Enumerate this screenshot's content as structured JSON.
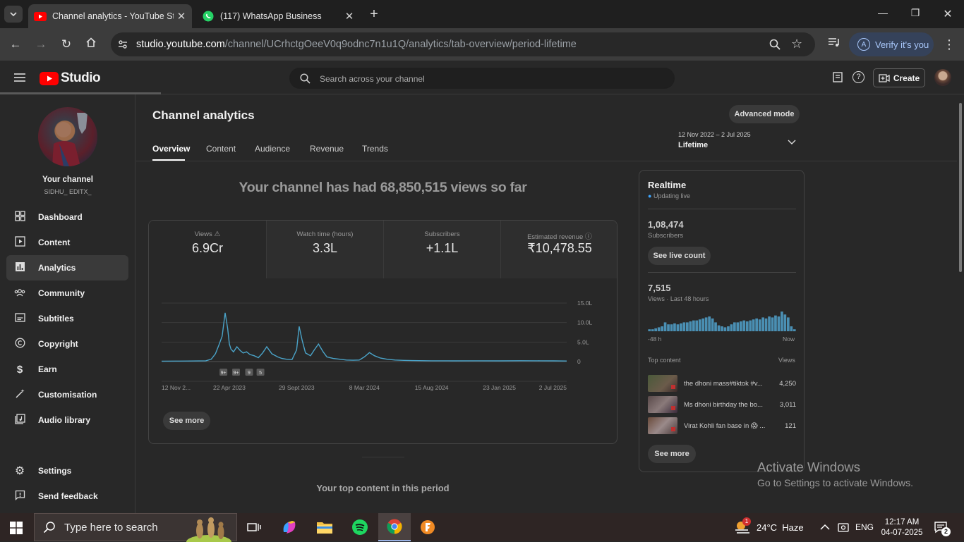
{
  "browser": {
    "tabs": [
      {
        "title": "Channel analytics - YouTube Studio",
        "active": true
      },
      {
        "title": "(117) WhatsApp Business",
        "active": false
      }
    ],
    "url_host": "studio.youtube.com",
    "url_path": "/channel/UCrhctgOeeV0q9odnc7n1u1Q/analytics/tab-overview/period-lifetime",
    "verify_label": "Verify it's you",
    "verify_initial": "A"
  },
  "studio": {
    "logo_text": "Studio",
    "search_placeholder": "Search across your channel",
    "create_label": "Create"
  },
  "sidebar": {
    "channel_label": "Your channel",
    "channel_name": "SIDHU_ EDITX_",
    "items": [
      {
        "label": "Dashboard",
        "icon": "dashboard-icon"
      },
      {
        "label": "Content",
        "icon": "content-icon"
      },
      {
        "label": "Analytics",
        "icon": "analytics-icon",
        "selected": true
      },
      {
        "label": "Community",
        "icon": "community-icon"
      },
      {
        "label": "Subtitles",
        "icon": "subtitles-icon"
      },
      {
        "label": "Copyright",
        "icon": "copyright-icon"
      },
      {
        "label": "Earn",
        "icon": "earn-icon"
      },
      {
        "label": "Customisation",
        "icon": "customisation-icon"
      },
      {
        "label": "Audio library",
        "icon": "audio-library-icon"
      }
    ],
    "bottom_items": [
      {
        "label": "Settings",
        "icon": "gear-icon"
      },
      {
        "label": "Send feedback",
        "icon": "feedback-icon"
      }
    ]
  },
  "analytics": {
    "page_title": "Channel analytics",
    "advanced_mode_label": "Advanced mode",
    "tabs": [
      "Overview",
      "Content",
      "Audience",
      "Revenue",
      "Trends"
    ],
    "period_range": "12 Nov 2022 – 2 Jul 2025",
    "period_label": "Lifetime",
    "headline": "Your channel has had 68,850,515 views so far",
    "metrics": [
      {
        "label": "Views",
        "value": "6.9Cr"
      },
      {
        "label": "Watch time (hours)",
        "value": "3.3L"
      },
      {
        "label": "Subscribers",
        "value": "+1.1L"
      },
      {
        "label": "Estimated revenue",
        "value": "₹10,478.55"
      }
    ],
    "see_more_label": "See more",
    "top_content_heading": "Your top content in this period"
  },
  "chart_data": {
    "type": "line",
    "x_ticks": [
      "12 Nov 2...",
      "22 Apr 2023",
      "29 Sept 2023",
      "8 Mar 2024",
      "15 Aug 2024",
      "23 Jan 2025",
      "2 Jul 2025"
    ],
    "y_ticks": [
      "15.0L",
      "10.0L",
      "5.0L",
      "0"
    ],
    "ylim": [
      0,
      1500000
    ],
    "grid": true,
    "series": [
      {
        "x": [
          "2022-11-12",
          "2022-12-15",
          "2023-01-20",
          "2023-02-25",
          "2023-03-10",
          "2023-03-20",
          "2023-03-28",
          "2023-04-05",
          "2023-04-12",
          "2023-04-18",
          "2023-04-22",
          "2023-04-26",
          "2023-05-02",
          "2023-05-10",
          "2023-05-18",
          "2023-05-25",
          "2023-06-02",
          "2023-06-10",
          "2023-06-20",
          "2023-06-30",
          "2023-07-10",
          "2023-07-20",
          "2023-08-01",
          "2023-08-15",
          "2023-08-25",
          "2023-09-05",
          "2023-09-18",
          "2023-09-29",
          "2023-10-05",
          "2023-10-12",
          "2023-10-20",
          "2023-11-01",
          "2023-11-10",
          "2023-11-20",
          "2023-12-01",
          "2023-12-10",
          "2023-12-25",
          "2024-01-10",
          "2024-01-25",
          "2024-02-10",
          "2024-02-25",
          "2024-03-08",
          "2024-03-20",
          "2024-04-01",
          "2024-04-15",
          "2024-05-01",
          "2024-05-20",
          "2024-06-10",
          "2024-07-01",
          "2024-08-15",
          "2024-10-01",
          "2024-12-01",
          "2025-01-23",
          "2025-03-15",
          "2025-05-01",
          "2025-06-01",
          "2025-07-02"
        ],
        "values": [
          10000,
          12000,
          15000,
          20000,
          60000,
          200000,
          420000,
          650000,
          1250000,
          850000,
          450000,
          320000,
          250000,
          380000,
          280000,
          220000,
          250000,
          180000,
          150000,
          100000,
          220000,
          380000,
          200000,
          120000,
          80000,
          60000,
          50000,
          300000,
          900000,
          550000,
          220000,
          150000,
          300000,
          450000,
          250000,
          120000,
          80000,
          60000,
          40000,
          35000,
          40000,
          120000,
          230000,
          150000,
          90000,
          60000,
          40000,
          30000,
          25000,
          20000,
          18000,
          20000,
          18000,
          22000,
          20000,
          18000,
          15000
        ]
      }
    ]
  },
  "realtime": {
    "title": "Realtime",
    "status": "Updating live",
    "subscribers_value": "1,08,474",
    "subscribers_label": "Subscribers",
    "see_live_count_label": "See live count",
    "views_value": "7,515",
    "views_label": "Views · Last 48 hours",
    "axis_left": "-48 h",
    "axis_right": "Now",
    "hourly_bars": [
      2,
      2,
      3,
      4,
      5,
      9,
      7,
      7,
      8,
      7,
      8,
      9,
      9,
      10,
      11,
      11,
      12,
      13,
      14,
      15,
      13,
      9,
      6,
      5,
      4,
      5,
      7,
      9,
      9,
      10,
      11,
      10,
      11,
      12,
      13,
      12,
      14,
      13,
      15,
      14,
      16,
      15,
      20,
      17,
      14,
      5,
      2
    ],
    "top_content_label": "Top content",
    "views_col_label": "Views",
    "top_content": [
      {
        "title": "the dhoni mass#tiktok #v...",
        "views": "4,250"
      },
      {
        "title": "Ms dhoni birthday the bo...",
        "views": "3,011"
      },
      {
        "title": "Virat Kohli fan base in 😱 ...",
        "views": "121"
      }
    ],
    "see_more_label": "See more"
  },
  "watermark": {
    "line1": "Activate Windows",
    "line2": "Go to Settings to activate Windows."
  },
  "taskbar": {
    "search_placeholder": "Type here to search",
    "weather_temp": "24°C",
    "weather_text": "Haze",
    "weather_badge": "1",
    "language": "ENG",
    "time": "12:17 AM",
    "date": "04-07-2025",
    "notification_count": "2"
  }
}
